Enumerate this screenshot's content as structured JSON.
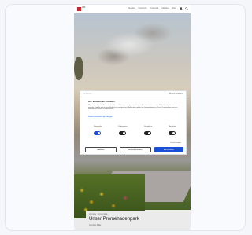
{
  "nav": {
    "logo_text": "UNI",
    "links": [
      "Studium",
      "Forschung",
      "Universität",
      "Aktuelles",
      "Shop"
    ]
  },
  "consent": {
    "brand": "Cookiebot",
    "powered_by": "Usercentrics",
    "title": "Wir verwenden Cookies",
    "body": "Wir verwenden Cookies, um Inhalte und Anzeigen zu personalisieren, Funktionen für soziale Medien anbieten zu können und die Zugriffe auf unsere Website zu analysieren. Außerdem geben wir Informationen zu Ihrer Verwendung unserer Website an unsere Partner weiter.",
    "link": "Datenschutzerklärung anzeigen",
    "toggles": [
      {
        "label": "Notwendig",
        "on": true
      },
      {
        "label": "Präferenzen",
        "on": false
      },
      {
        "label": "Statistiken",
        "on": false
      },
      {
        "label": "Marketing",
        "on": false
      }
    ],
    "details_label": "Details zeigen",
    "buttons": {
      "deny": "Ablehnen",
      "allow_selection": "Auswahl erlauben",
      "allow_all": "Alle zulassen"
    }
  },
  "article": {
    "kicker": "Campus · Universität",
    "headline": "Unser Promenadenpark",
    "subtitle": "Campus Mitte"
  },
  "colors": {
    "accent": "#1a4fd8",
    "brand_red": "#c62828"
  }
}
